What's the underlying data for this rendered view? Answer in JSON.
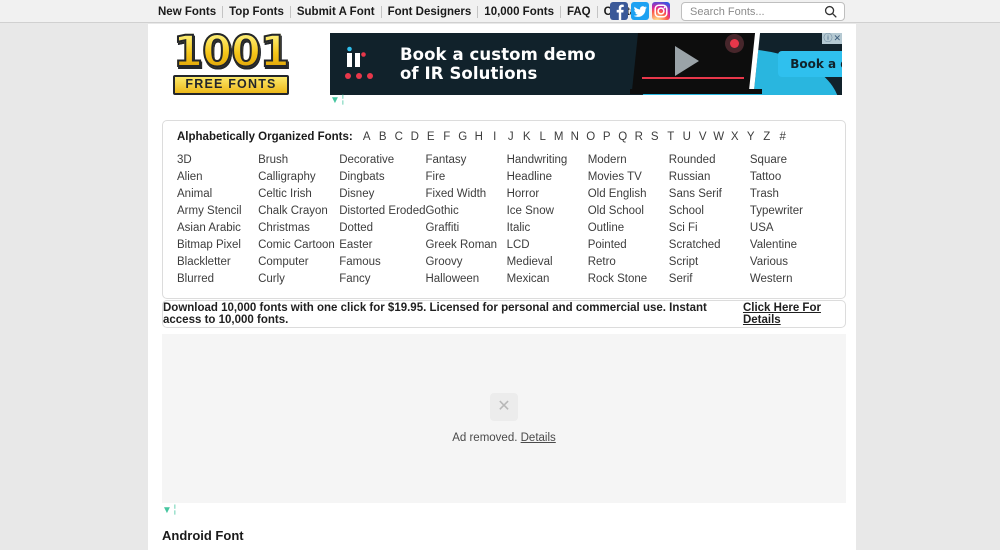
{
  "topnav": {
    "links": [
      "New Fonts",
      "Top Fonts",
      "Submit A Font",
      "Font Designers",
      "10,000 Fonts",
      "FAQ",
      "Contact"
    ],
    "social": [
      {
        "name": "facebook-icon",
        "label": "f"
      },
      {
        "name": "twitter-icon",
        "label": "t"
      },
      {
        "name": "instagram-icon",
        "label": "ig"
      }
    ],
    "search": {
      "placeholder": "Search Fonts...",
      "value": "",
      "icon": "search-icon"
    }
  },
  "logo": {
    "line1": "1001",
    "line2": "FREE FONTS"
  },
  "banner_ad": {
    "headline_line1": "Book a custom demo",
    "headline_line2": "of IR Solutions",
    "cta": "Book a demo",
    "adchoices_info": "ⓘ",
    "adchoices_close": "✕"
  },
  "alphabet": {
    "label": "Alphabetically Organized Fonts:",
    "letters": [
      "A",
      "B",
      "C",
      "D",
      "E",
      "F",
      "G",
      "H",
      "I",
      "J",
      "K",
      "L",
      "M",
      "N",
      "O",
      "P",
      "Q",
      "R",
      "S",
      "T",
      "U",
      "V",
      "W",
      "X",
      "Y",
      "Z",
      "#"
    ]
  },
  "categories": [
    "3D",
    "Brush",
    "Decorative",
    "Fantasy",
    "Handwriting",
    "Modern",
    "Rounded",
    "Square",
    "Alien",
    "Calligraphy",
    "Dingbats",
    "Fire",
    "Headline",
    "Movies TV",
    "Russian",
    "Tattoo",
    "Animal",
    "Celtic Irish",
    "Disney",
    "Fixed Width",
    "Horror",
    "Old English",
    "Sans Serif",
    "Trash",
    "Army Stencil",
    "Chalk Crayon",
    "Distorted Eroded",
    "Gothic",
    "Ice Snow",
    "Old School",
    "School",
    "Typewriter",
    "Asian Arabic",
    "Christmas",
    "Dotted",
    "Graffiti",
    "Italic",
    "Outline",
    "Sci Fi",
    "USA",
    "Bitmap Pixel",
    "Comic Cartoon",
    "Easter",
    "Greek Roman",
    "LCD",
    "Pointed",
    "Scratched",
    "Valentine",
    "Blackletter",
    "Computer",
    "Famous",
    "Groovy",
    "Medieval",
    "Retro",
    "Script",
    "Various",
    "Blurred",
    "Curly",
    "Fancy",
    "Halloween",
    "Mexican",
    "Rock Stone",
    "Serif",
    "Western"
  ],
  "promo": {
    "text": "Download 10,000 fonts with one click for $19.95. Licensed for personal and commercial use. Instant access to 10,000 fonts.",
    "link": "Click Here For Details"
  },
  "ad_slot": {
    "icon": "✕",
    "text": "Ad removed.",
    "link": "Details"
  },
  "font_section": {
    "title": "Android Font"
  },
  "colors": {
    "page_bg": "#e8e8e8",
    "content_bg": "#ffffff",
    "nav_bg": "#f1f1f1",
    "ad_slot_bg": "#f5f5f5",
    "logo_gold": "#f5c518",
    "banner_dark": "#11222b",
    "banner_cyan": "#2fc0ee",
    "funnel_green": "#46c6a0"
  }
}
